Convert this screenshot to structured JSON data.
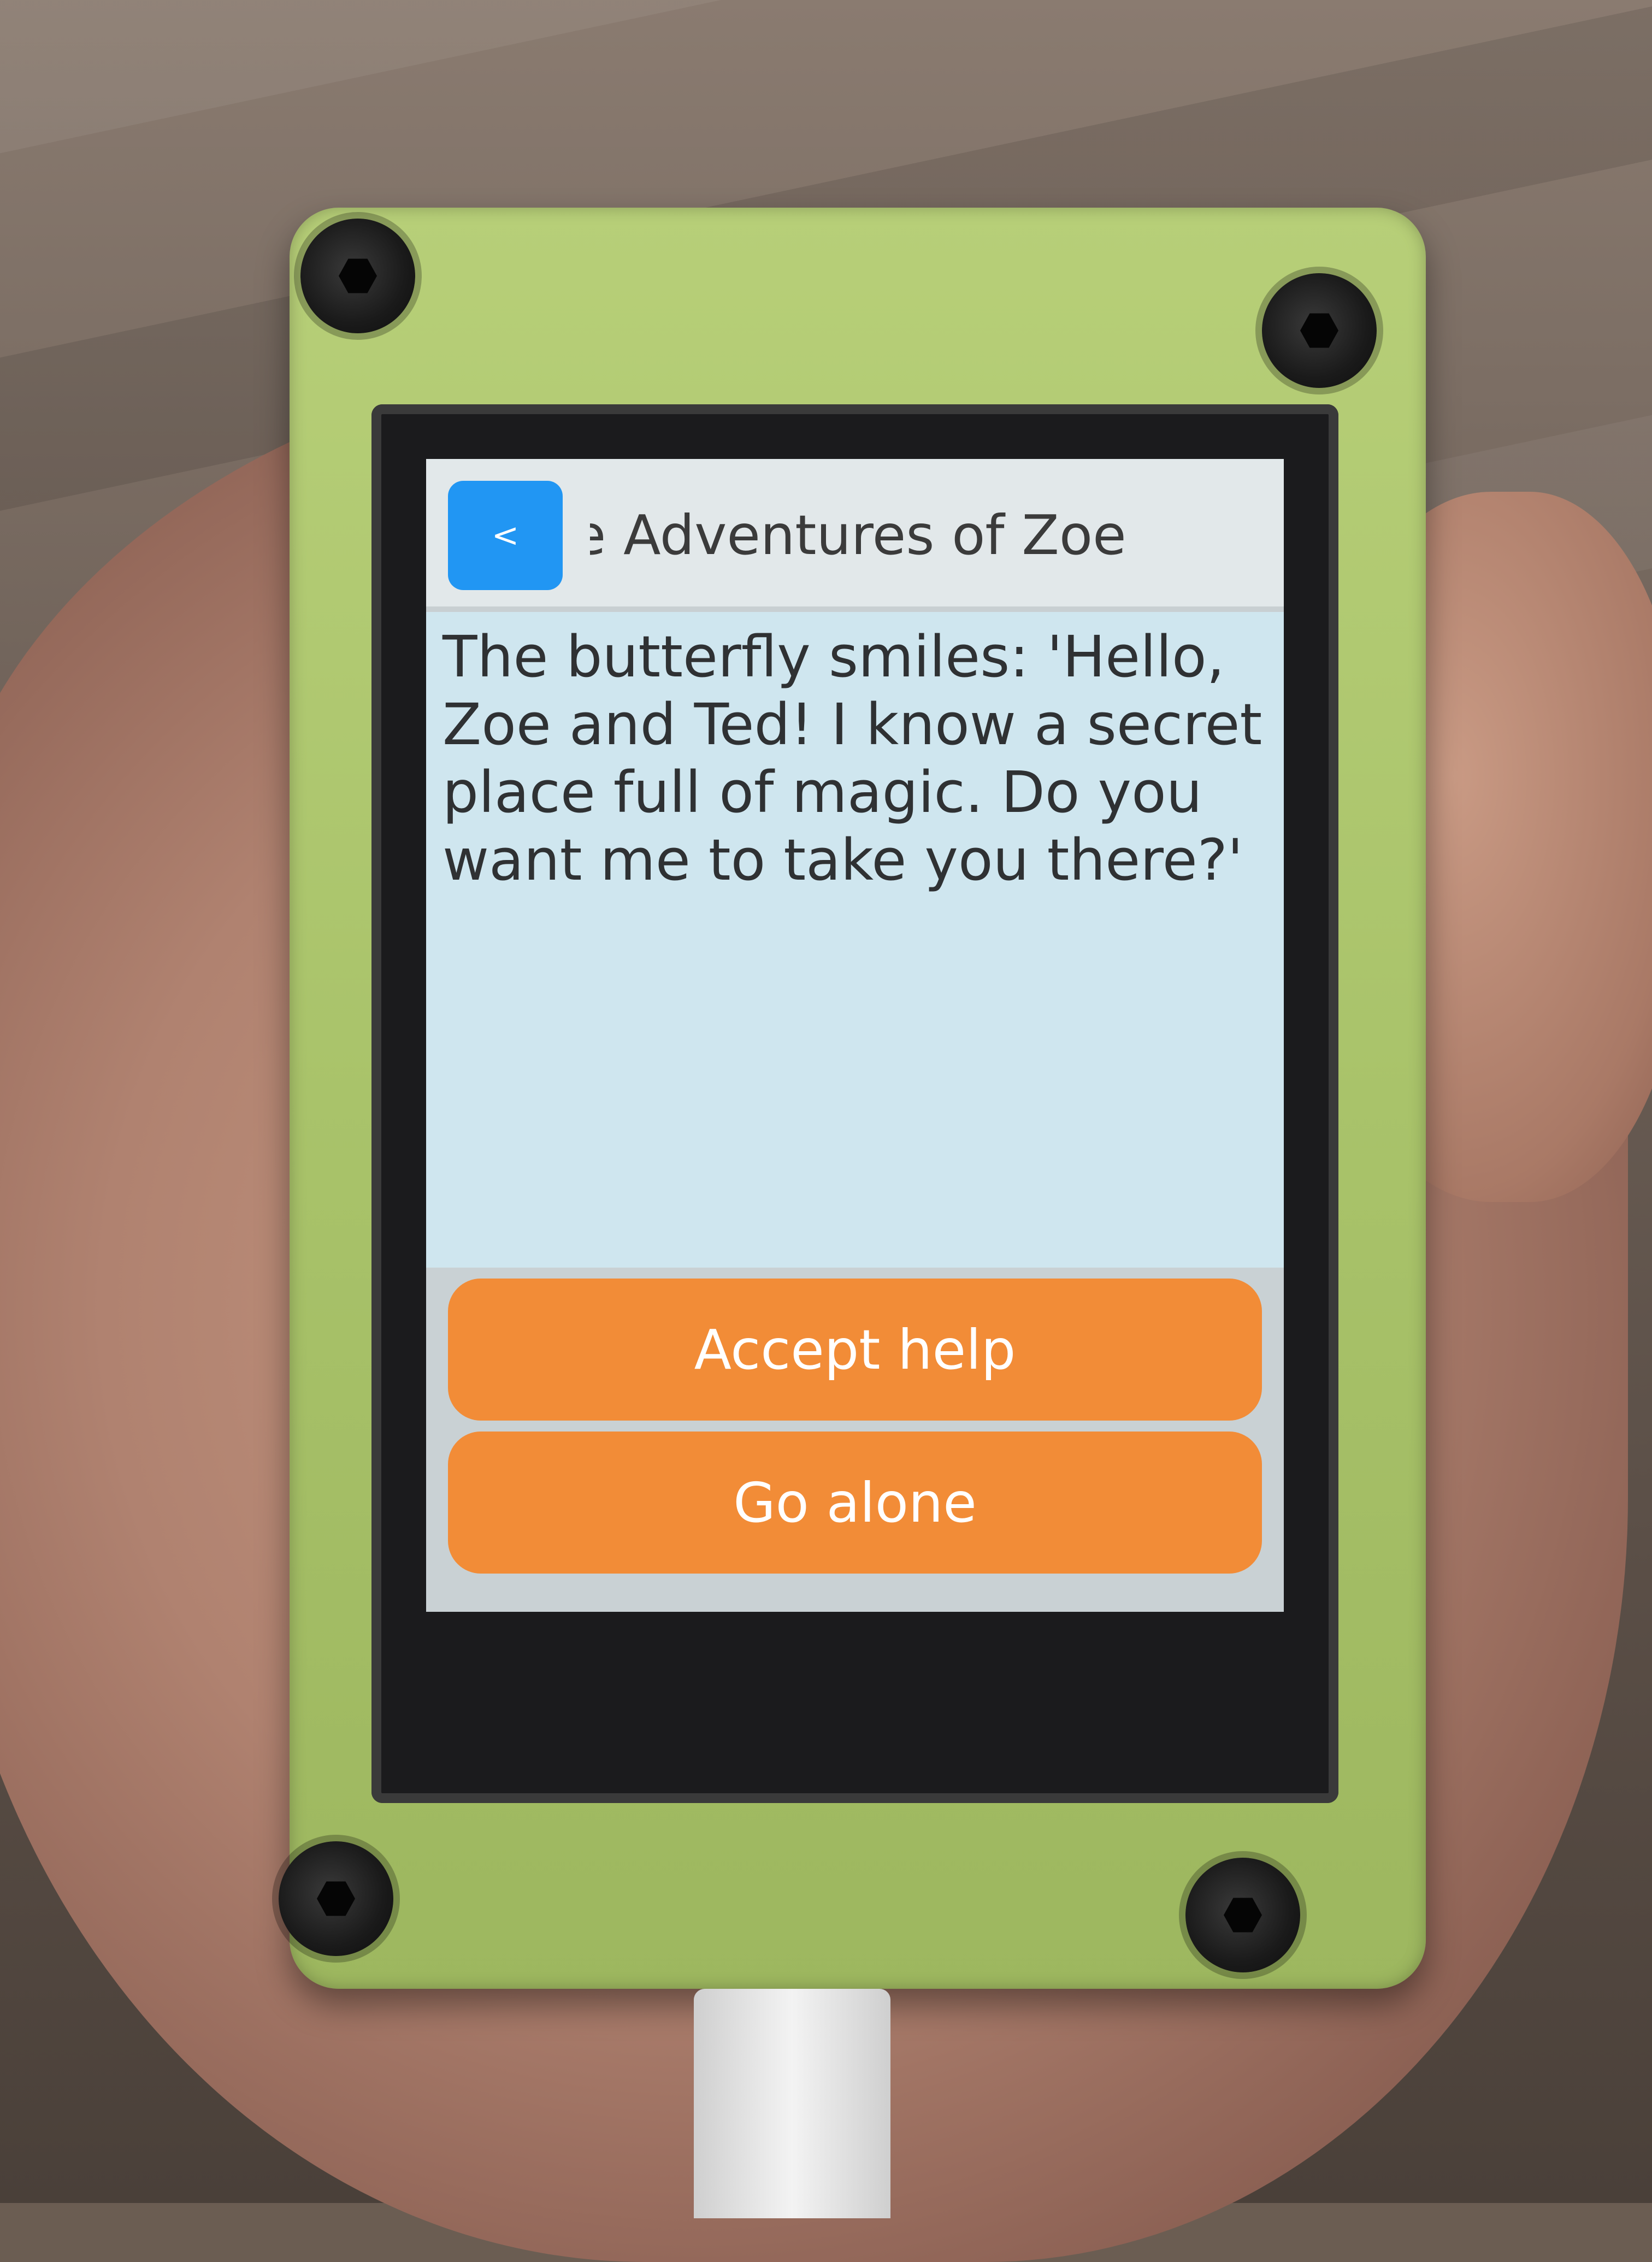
{
  "app": {
    "title": "ıe Adventures of Zoe",
    "back_label": "<"
  },
  "story": {
    "text": "The butterfly smiles: 'Hello, Zoe and Ted! I know a secret place full of magic. Do you want me to take you there?'"
  },
  "choices": [
    {
      "label": "Accept help"
    },
    {
      "label": "Go alone"
    }
  ],
  "colors": {
    "header_background": "#e2e8ea",
    "screen_background": "#cfe6ef",
    "back_button": "#2196f3",
    "choice_button": "#f28c37",
    "enclosure": "#a9c36a"
  }
}
